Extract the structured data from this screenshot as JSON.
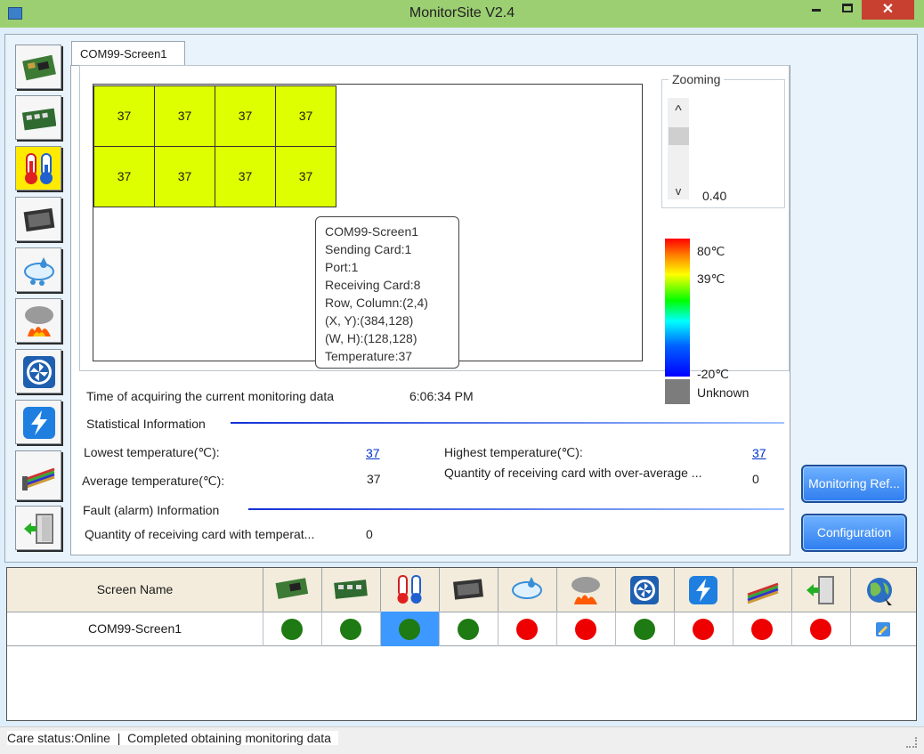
{
  "window": {
    "title": "MonitorSite V2.4",
    "close_glyph": "✕"
  },
  "tab": {
    "label": "COM99-Screen1"
  },
  "cells": [
    "37",
    "37",
    "37",
    "37",
    "37",
    "37",
    "37",
    "37"
  ],
  "tooltip": {
    "lines": [
      "COM99-Screen1",
      "Sending Card:1",
      "Port:1",
      "Receiving Card:8",
      "Row, Column:(2,4)",
      "(X, Y):(384,128)",
      "(W, H):(128,128)",
      "Temperature:37"
    ]
  },
  "zooming": {
    "label": "Zooming",
    "value": "0.40",
    "up_glyph": "^",
    "down_glyph": "v"
  },
  "legend": {
    "max": "80℃",
    "mid": "39℃",
    "min": "-20℃",
    "unknown": "Unknown",
    "colors": {
      "hot": "#ff0000",
      "warm": "#ffff00",
      "mild": "#00ff00",
      "cool": "#00ffff",
      "cold": "#0000ff",
      "unknown": "#7c7c7c"
    }
  },
  "acquire": {
    "label": "Time of acquiring the current monitoring data",
    "time": "6:06:34 PM"
  },
  "stats": {
    "section": "Statistical Information",
    "lowest_label": "Lowest temperature(℃):",
    "lowest_value": "37",
    "highest_label": "Highest temperature(℃):",
    "highest_value": "37",
    "average_label": "Average temperature(℃):",
    "average_value": "37",
    "over_avg_label": "Quantity of receiving card with over-average ...",
    "over_avg_value": "0"
  },
  "fault": {
    "section": "Fault (alarm) Information",
    "label": "Quantity of receiving card with temperat...",
    "value": "0"
  },
  "buttons": {
    "monitoring_refresh": "Monitoring Ref...",
    "configuration": "Configuration"
  },
  "sidebar_tools": [
    "sending-card-icon",
    "receiving-card-icon",
    "thermometer-icon",
    "module-card-icon",
    "humidity-icon",
    "smoke-fire-icon",
    "fan-icon",
    "power-icon",
    "cable-icon",
    "door-exit-icon"
  ],
  "table": {
    "header": {
      "screen_name": "Screen Name"
    },
    "rows": [
      {
        "name": "COM99-Screen1",
        "statuses": [
          "green",
          "green",
          "green",
          "green",
          "red",
          "red",
          "green",
          "red",
          "red",
          "red",
          "edit"
        ]
      }
    ],
    "status_colors": {
      "green": "#1e7a12",
      "red": "#ee0000",
      "selected_bg": "#3d99ff"
    }
  },
  "status_bar": {
    "text": "Care status:Online  |  Completed obtaining monitoring data"
  }
}
